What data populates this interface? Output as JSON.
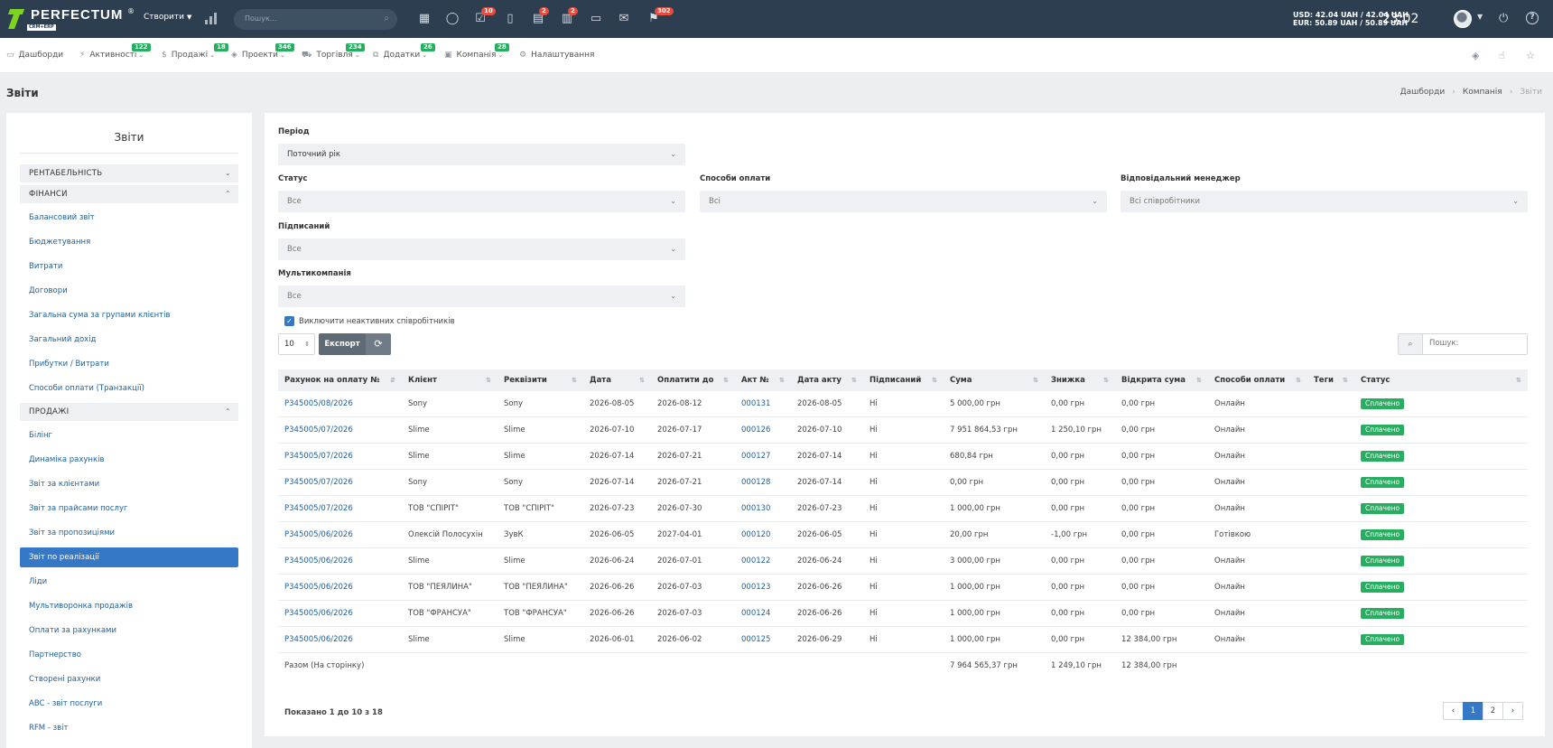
{
  "topbar": {
    "brand": "PERFECTUM",
    "brand_sub": "CRM+ERP",
    "create_label": "Створити",
    "search_placeholder": "Пошук...",
    "icons": [
      {
        "name": "calendar-grid-icon",
        "glyph": "▦",
        "badge": ""
      },
      {
        "name": "chat-icon",
        "glyph": "◯",
        "badge": ""
      },
      {
        "name": "tasks-check-icon",
        "glyph": "☑",
        "badge": "10"
      },
      {
        "name": "clipboard-icon",
        "glyph": "▯",
        "badge": ""
      },
      {
        "name": "messages-icon",
        "glyph": "▤",
        "badge": "2"
      },
      {
        "name": "notes-icon",
        "glyph": "▥",
        "badge": "2"
      },
      {
        "name": "file-icon",
        "glyph": "▭",
        "badge": ""
      },
      {
        "name": "mail-icon",
        "glyph": "✉",
        "badge": ""
      },
      {
        "name": "notifications-icon",
        "glyph": "⚑",
        "badge": "302"
      }
    ],
    "rates_usd": "USD: 42.04 UAH / 42.04 UAH",
    "rates_eur": "EUR: 50.89 UAH / 50.89 UAH",
    "clock": "23:02"
  },
  "nav": {
    "items": [
      {
        "label": "Дашборди",
        "icon": "▭",
        "badge": "",
        "caret": false
      },
      {
        "label": "Активності",
        "icon": "⚡",
        "badge": "122",
        "caret": true
      },
      {
        "label": "Продажі",
        "icon": "$",
        "badge": "18",
        "caret": true
      },
      {
        "label": "Проекти",
        "icon": "◈",
        "badge": "346",
        "caret": true
      },
      {
        "label": "Торгівля",
        "icon": "⛟",
        "badge": "234",
        "caret": true
      },
      {
        "label": "Додатки",
        "icon": "⧉",
        "badge": "26",
        "caret": true
      },
      {
        "label": "Компанія",
        "icon": "▣",
        "badge": "28",
        "caret": true
      },
      {
        "label": "Налаштування",
        "icon": "⚙",
        "badge": "",
        "caret": false
      }
    ]
  },
  "page": {
    "title": "Звіти",
    "breadcrumb": [
      "Дашборди",
      "Компанія",
      "Звіти"
    ]
  },
  "sidebar": {
    "title": "Звіти",
    "sections": [
      {
        "label": "РЕНТАБЕЛЬНІСТЬ",
        "open": false,
        "items": []
      },
      {
        "label": "ФІНАНСИ",
        "open": true,
        "items": [
          "Балансовий звіт",
          "Бюджетування",
          "Витрати",
          "Договори",
          "Загальна сума за групами клієнтів",
          "Загальний дохід",
          "Прибутки / Витрати",
          "Способи оплати (Транзакції)"
        ]
      },
      {
        "label": "ПРОДАЖІ",
        "open": true,
        "items": [
          "Білінг",
          "Динаміка рахунків",
          "Звіт за клієнтами",
          "Звіт за прайсами послуг",
          "Звіт за пропозиціями",
          "Звіт по реалізації",
          "Ліди",
          "Мультиворонка продажів",
          "Оплати за рахунками",
          "Партнерство",
          "Створені рахунки",
          "ABC - звіт послуги",
          "RFM - звіт"
        ]
      }
    ],
    "active_item": "Звіт по реалізації"
  },
  "filters": {
    "period_label": "Період",
    "period_value": "Поточний рік",
    "status_label": "Статус",
    "status_value": "Все",
    "payment_label": "Способи оплати",
    "payment_value": "Всі",
    "manager_label": "Відповідальний менеджер",
    "manager_value": "Всі співробітники",
    "signed_label": "Підписаний",
    "signed_value": "Все",
    "multicompany_label": "Мультикомпанія",
    "multicompany_value": "Все",
    "exclude_inactive": "Виключити неактивних співробітників",
    "exclude_checked": true
  },
  "toolbar": {
    "page_length": "10",
    "export_label": "Експорт",
    "search_placeholder": "Пошук:"
  },
  "table": {
    "columns": [
      "Рахунок на оплату №",
      "Клієнт",
      "Реквізити",
      "Дата",
      "Оплатити до",
      "Акт №",
      "Дата акту",
      "Підписаний",
      "Сума",
      "Знижка",
      "Відкрита сума",
      "Способи оплати",
      "Теги",
      "Статус"
    ],
    "rows": [
      [
        "P345005/08/2026",
        "Sony",
        "Sony",
        "2026-08-05",
        "2026-08-12",
        "000131",
        "2026-08-05",
        "Ні",
        "5 000,00 грн",
        "0,00 грн",
        "0,00 грн",
        "Онлайн",
        "",
        "Сплачено"
      ],
      [
        "P345005/07/2026",
        "Slime",
        "Slime",
        "2026-07-10",
        "2026-07-17",
        "000126",
        "2026-07-10",
        "Ні",
        "7 951 864,53 грн",
        "1 250,10 грн",
        "0,00 грн",
        "Онлайн",
        "",
        "Сплачено"
      ],
      [
        "P345005/07/2026",
        "Slime",
        "Slime",
        "2026-07-14",
        "2026-07-21",
        "000127",
        "2026-07-14",
        "Ні",
        "680,84 грн",
        "0,00 грн",
        "0,00 грн",
        "Онлайн",
        "",
        "Сплачено"
      ],
      [
        "P345005/07/2026",
        "Sony",
        "Sony",
        "2026-07-14",
        "2026-07-21",
        "000128",
        "2026-07-14",
        "Ні",
        "0,00 грн",
        "0,00 грн",
        "0,00 грн",
        "Онлайн",
        "",
        "Сплачено"
      ],
      [
        "P345005/07/2026",
        "ТОВ \"СПІРІТ\"",
        "ТОВ \"СПІРІТ\"",
        "2026-07-23",
        "2026-07-30",
        "000130",
        "2026-07-23",
        "Ні",
        "1 000,00 грн",
        "0,00 грн",
        "0,00 грн",
        "Онлайн",
        "",
        "Сплачено"
      ],
      [
        "P345005/06/2026",
        "Олексій Полосухін",
        "ЗувК",
        "2026-06-05",
        "2027-04-01",
        "000120",
        "2026-06-05",
        "Ні",
        "20,00 грн",
        "-1,00 грн",
        "0,00 грн",
        "Готівкою",
        "",
        "Сплачено"
      ],
      [
        "P345005/06/2026",
        "Slime",
        "Slime",
        "2026-06-24",
        "2026-07-01",
        "000122",
        "2026-06-24",
        "Ні",
        "3 000,00 грн",
        "0,00 грн",
        "0,00 грн",
        "Онлайн",
        "",
        "Сплачено"
      ],
      [
        "P345005/06/2026",
        "ТОВ \"ПЕЯЛИНА\"",
        "ТОВ \"ПЕЯЛИНА\"",
        "2026-06-26",
        "2026-07-03",
        "000123",
        "2026-06-26",
        "Ні",
        "1 000,00 грн",
        "0,00 грн",
        "0,00 грн",
        "Онлайн",
        "",
        "Сплачено"
      ],
      [
        "P345005/06/2026",
        "ТОВ \"ФРАНСУА\"",
        "ТОВ \"ФРАНСУА\"",
        "2026-06-26",
        "2026-07-03",
        "000124",
        "2026-06-26",
        "Ні",
        "1 000,00 грн",
        "0,00 грн",
        "0,00 грн",
        "Онлайн",
        "",
        "Сплачено"
      ],
      [
        "P345005/06/2026",
        "Slime",
        "Slime",
        "2026-06-01",
        "2026-06-02",
        "000125",
        "2026-06-29",
        "Ні",
        "1 000,00 грн",
        "0,00 грн",
        "12 384,00 грн",
        "Онлайн",
        "",
        "Сплачено"
      ]
    ],
    "totals_label": "Разом (На сторінку)",
    "totals_sum": "7 964 565,37 грн",
    "totals_discount": "1 249,10 грн",
    "totals_open": "12 384,00 грн"
  },
  "footer": {
    "showing": "Показано 1 до 10 з 18",
    "pages": [
      "‹",
      "1",
      "2",
      "›"
    ],
    "active_page": "1"
  },
  "colors": {
    "topbar": "#2c3e50",
    "accent": "#3478c6",
    "success": "#27ae60",
    "danger": "#e74c3c",
    "link": "#1f5f99"
  }
}
